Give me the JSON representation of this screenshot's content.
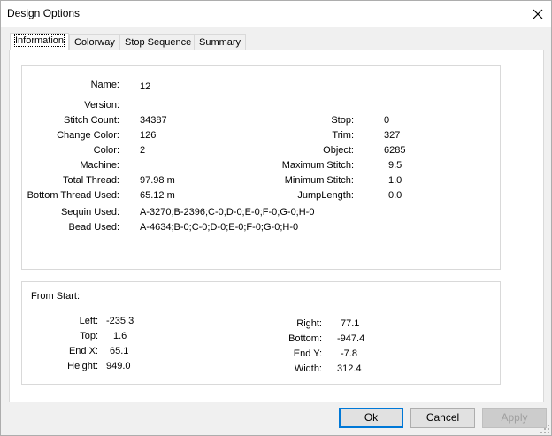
{
  "window": {
    "title": "Design Options",
    "close_glyph": "close-icon"
  },
  "tabs": [
    {
      "label": "Information",
      "active": true
    },
    {
      "label": "Colorway",
      "active": false
    },
    {
      "label": "Stop Sequence",
      "active": false
    },
    {
      "label": "Summary",
      "active": false
    }
  ],
  "info": {
    "name_label": "Name:",
    "name_value": "12",
    "version_label": "Version:",
    "version_value": "",
    "stitch_count_label": "Stitch Count:",
    "stitch_count_value": "34387",
    "change_color_label": "Change Color:",
    "change_color_value": "126",
    "color_label": "Color:",
    "color_value": "2",
    "machine_label": "Machine:",
    "machine_value": "",
    "total_thread_label": "Total Thread:",
    "total_thread_value": "97.98 m",
    "bottom_thread_label": "Bottom Thread Used:",
    "bottom_thread_value": "65.12 m",
    "sequin_label": "Sequin Used:",
    "sequin_value": "A-3270;B-2396;C-0;D-0;E-0;F-0;G-0;H-0",
    "bead_label": "Bead Used:",
    "bead_value": "A-4634;B-0;C-0;D-0;E-0;F-0;G-0;H-0",
    "stop_label": "Stop:",
    "stop_value": "0",
    "trim_label": "Trim:",
    "trim_value": "327",
    "object_label": "Object:",
    "object_value": "6285",
    "max_stitch_label": "Maximum Stitch:",
    "max_stitch_value": "9.5",
    "min_stitch_label": "Minimum Stitch:",
    "min_stitch_value": "1.0",
    "jump_length_label": "JumpLength:",
    "jump_length_value": "0.0"
  },
  "from_start": {
    "heading": "From Start:",
    "left_label": "Left:",
    "left_value": "-235.3",
    "top_label": "Top:",
    "top_value": "1.6",
    "end_x_label": "End X:",
    "end_x_value": "65.1",
    "height_label": "Height:",
    "height_value": "949.0",
    "right_label": "Right:",
    "right_value": "77.1",
    "bottom_label": "Bottom:",
    "bottom_value": "-947.4",
    "end_y_label": "End Y:",
    "end_y_value": "-7.8",
    "width_label": "Width:",
    "width_value": "312.4"
  },
  "buttons": {
    "ok": "Ok",
    "cancel": "Cancel",
    "apply": "Apply"
  },
  "colors": {
    "focus_border": "#0078d7",
    "disabled_text": "#a0a0a0"
  }
}
